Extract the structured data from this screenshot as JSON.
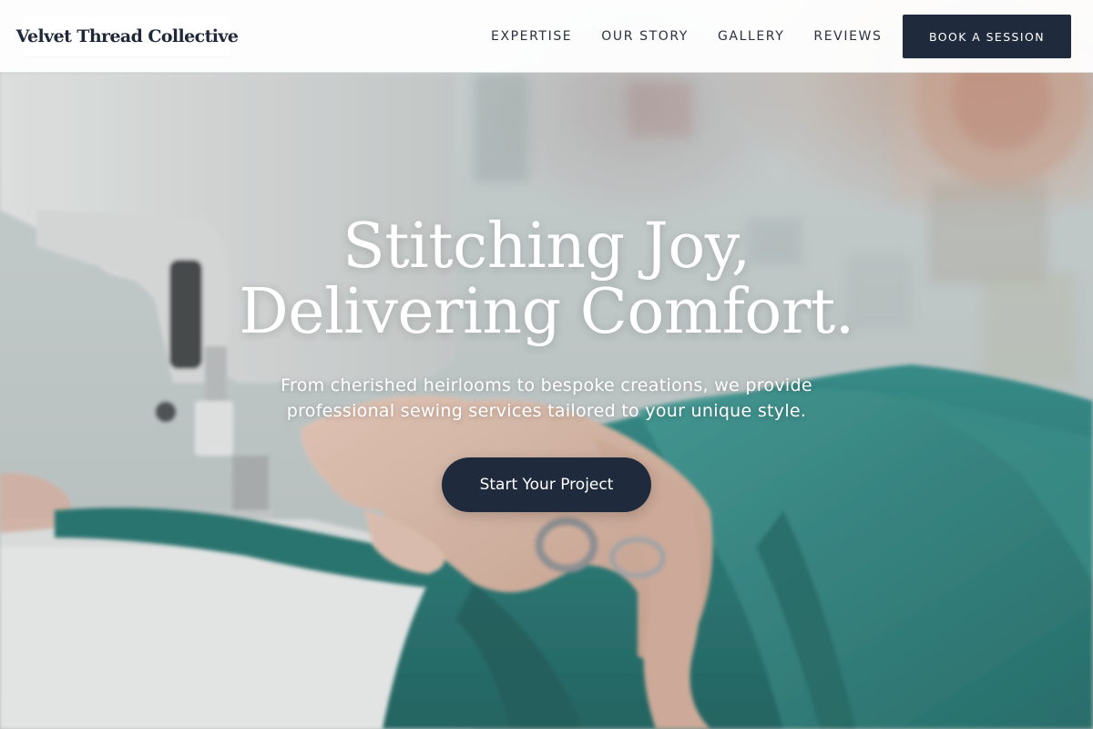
{
  "brand": {
    "name": "Velvet Thread Collective"
  },
  "nav": {
    "items": [
      {
        "label": "EXPERTISE"
      },
      {
        "label": "OUR STORY"
      },
      {
        "label": "GALLERY"
      },
      {
        "label": "REVIEWS"
      }
    ],
    "cta_label": "BOOK A SESSION"
  },
  "hero": {
    "title_line1": "Stitching Joy,",
    "title_line2": "Delivering Comfort.",
    "subtitle": "From cherished heirlooms to bespoke creations, we provide professional sewing services tailored to your unique style.",
    "button_label": "Start Your Project"
  },
  "colors": {
    "brand_navy": "#1f2a3c",
    "fabric_teal": "#1f7a76",
    "text_on_hero": "#ffffff"
  }
}
